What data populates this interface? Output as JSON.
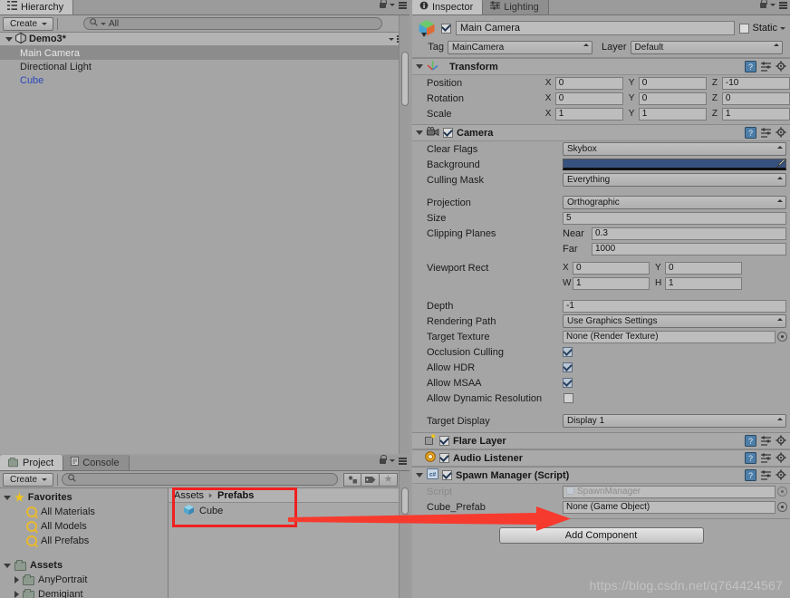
{
  "hierarchy": {
    "tab_label": "Hierarchy",
    "tab_icon": "hierarchy-icon",
    "create_label": "Create",
    "search_placeholder": "All",
    "scene_name": "Demo3*",
    "items": [
      {
        "label": "Main Camera",
        "selected": true,
        "prefab": false
      },
      {
        "label": "Directional Light",
        "selected": false,
        "prefab": false
      },
      {
        "label": "Cube",
        "selected": false,
        "prefab": true
      }
    ]
  },
  "inspector": {
    "tabs": [
      {
        "label": "Inspector",
        "active": true,
        "icon": "info-icon"
      },
      {
        "label": "Lighting",
        "active": false,
        "icon": "lighting-icon"
      }
    ],
    "object_name": "Main Camera",
    "object_enabled": true,
    "static_label": "Static",
    "static_checked": false,
    "tag_label": "Tag",
    "tag_value": "MainCamera",
    "layer_label": "Layer",
    "layer_value": "Default",
    "transform": {
      "title": "Transform",
      "rows": [
        {
          "label": "Position",
          "x": "0",
          "y": "0",
          "z": "-10"
        },
        {
          "label": "Rotation",
          "x": "0",
          "y": "0",
          "z": "0"
        },
        {
          "label": "Scale",
          "x": "1",
          "y": "1",
          "z": "1"
        }
      ]
    },
    "camera": {
      "title": "Camera",
      "enabled": true,
      "clear_flags_label": "Clear Flags",
      "clear_flags_value": "Skybox",
      "background_label": "Background",
      "background_color": "#37527e",
      "culling_mask_label": "Culling Mask",
      "culling_mask_value": "Everything",
      "projection_label": "Projection",
      "projection_value": "Orthographic",
      "size_label": "Size",
      "size_value": "5",
      "clipping_label": "Clipping Planes",
      "near_label": "Near",
      "near_value": "0.3",
      "far_label": "Far",
      "far_value": "1000",
      "viewport_label": "Viewport Rect",
      "viewport_x": "0",
      "viewport_y": "0",
      "viewport_w": "1",
      "viewport_h": "1",
      "depth_label": "Depth",
      "depth_value": "-1",
      "rendering_path_label": "Rendering Path",
      "rendering_path_value": "Use Graphics Settings",
      "target_texture_label": "Target Texture",
      "target_texture_value": "None (Render Texture)",
      "occlusion_label": "Occlusion Culling",
      "occlusion_checked": true,
      "hdr_label": "Allow HDR",
      "hdr_checked": true,
      "msaa_label": "Allow MSAA",
      "msaa_checked": true,
      "dynres_label": "Allow Dynamic Resolution",
      "dynres_checked": false,
      "target_display_label": "Target Display",
      "target_display_value": "Display 1"
    },
    "flare_layer": {
      "title": "Flare Layer",
      "enabled": true
    },
    "audio_listener": {
      "title": "Audio Listener",
      "enabled": true
    },
    "spawn_manager": {
      "title": "Spawn Manager (Script)",
      "enabled": true,
      "script_label": "Script",
      "script_value": "SpawnManager",
      "prefab_label": "Cube_Prefab",
      "prefab_value": "None (Game Object)"
    },
    "add_component_label": "Add Component"
  },
  "project": {
    "tabs": [
      {
        "label": "Project",
        "active": true,
        "icon": "folder-icon"
      },
      {
        "label": "Console",
        "active": false,
        "icon": "console-icon"
      }
    ],
    "create_label": "Create",
    "search_placeholder": "",
    "tree": [
      {
        "label": "Favorites",
        "type": "root",
        "icon": "star-icon"
      },
      {
        "label": "All Materials",
        "type": "search",
        "icon": "magnifier-icon"
      },
      {
        "label": "All Models",
        "type": "search",
        "icon": "magnifier-icon"
      },
      {
        "label": "All Prefabs",
        "type": "search",
        "icon": "magnifier-icon"
      },
      {
        "label": "Assets",
        "type": "root",
        "icon": "folder-icon"
      },
      {
        "label": "AnyPortrait",
        "type": "folder",
        "icon": "folder-icon"
      },
      {
        "label": "Demigiant",
        "type": "folder",
        "icon": "folder-icon"
      }
    ],
    "breadcrumb": [
      "Assets",
      "Prefabs"
    ],
    "assets": [
      {
        "label": "Cube",
        "icon": "prefab-cube-icon"
      }
    ]
  },
  "annotations": {
    "watermark": "https://blog.csdn.net/q764424567",
    "highlight_color": "#f02020"
  }
}
